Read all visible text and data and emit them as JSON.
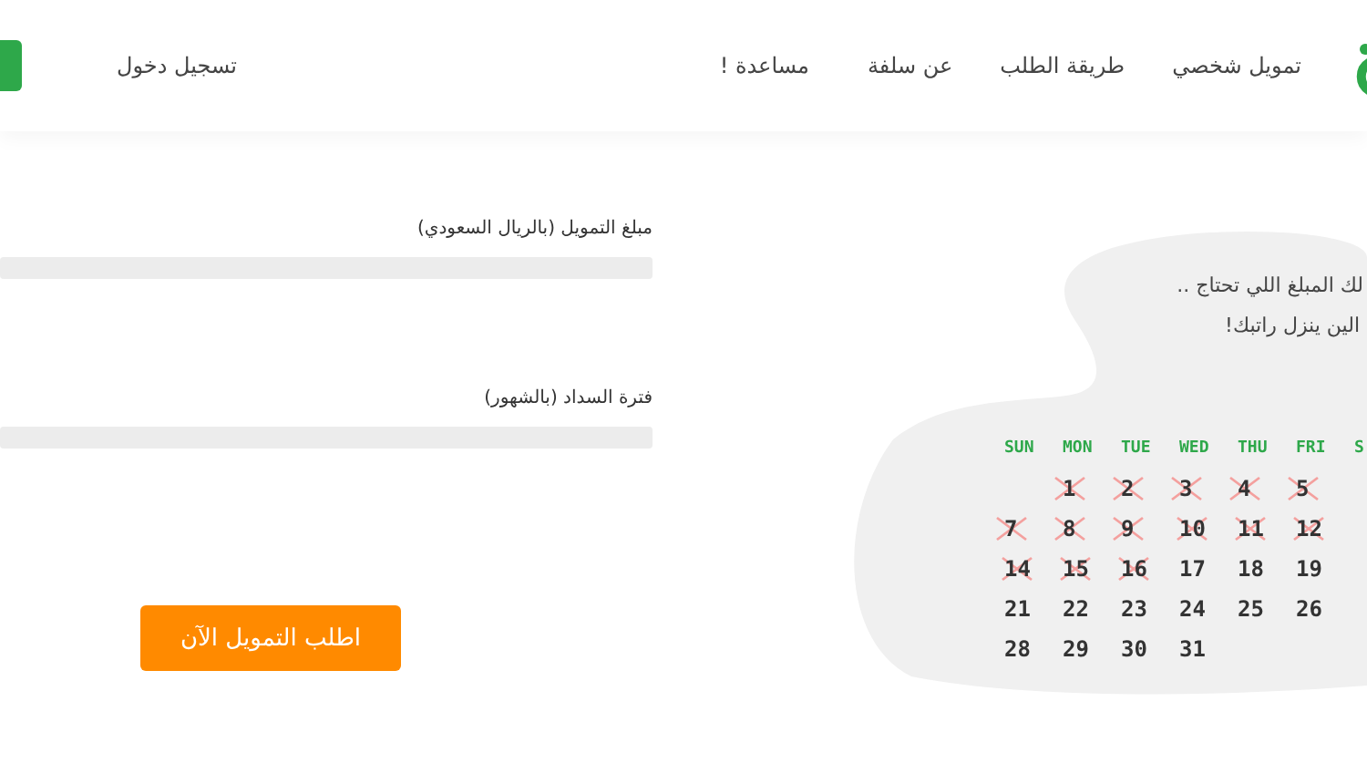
{
  "nav": {
    "items": [
      {
        "label": "تمويل شخصي"
      },
      {
        "label": "طريقة الطلب"
      },
      {
        "label": "عن سلفة"
      },
      {
        "label": "مساعدة !"
      }
    ],
    "login": "تسجيل دخول"
  },
  "promo": {
    "lines": [
      "لك المبلغ اللي تحتاج ..",
      "الين ينزل راتبك!"
    ]
  },
  "calendar": {
    "headers": [
      "S",
      "FRI",
      "THU",
      "WED",
      "TUE",
      "MON",
      "SUN"
    ],
    "rows": [
      [
        {
          "day": "5",
          "crossed": true
        },
        {
          "day": "4",
          "crossed": true
        },
        {
          "day": "3",
          "crossed": true
        },
        {
          "day": "2",
          "crossed": true
        },
        {
          "day": "1",
          "crossed": true
        }
      ],
      [
        {
          "day": "12",
          "crossed": true
        },
        {
          "day": "11",
          "crossed": true
        },
        {
          "day": "10",
          "crossed": true
        },
        {
          "day": "9",
          "crossed": true
        },
        {
          "day": "8",
          "crossed": true
        },
        {
          "day": "7",
          "crossed": true
        }
      ],
      [
        {
          "day": "19",
          "crossed": false
        },
        {
          "day": "18",
          "crossed": false
        },
        {
          "day": "17",
          "crossed": false
        },
        {
          "day": "16",
          "crossed": true
        },
        {
          "day": "15",
          "crossed": true
        },
        {
          "day": "14",
          "crossed": true
        }
      ],
      [
        {
          "day": "26",
          "crossed": false
        },
        {
          "day": "25",
          "crossed": false
        },
        {
          "day": "24",
          "crossed": false
        },
        {
          "day": "23",
          "crossed": false
        },
        {
          "day": "22",
          "crossed": false
        },
        {
          "day": "21",
          "crossed": false
        }
      ],
      [
        null,
        null,
        {
          "day": "31",
          "crossed": false
        },
        {
          "day": "30",
          "crossed": false
        },
        {
          "day": "29",
          "crossed": false
        },
        {
          "day": "28",
          "crossed": false
        }
      ]
    ]
  },
  "form": {
    "fields": [
      {
        "label": "مبلغ التمويل (بالريال السعودي)"
      },
      {
        "label": "فترة السداد (بالشهور)"
      }
    ],
    "submit": "اطلب التمويل الآن"
  }
}
